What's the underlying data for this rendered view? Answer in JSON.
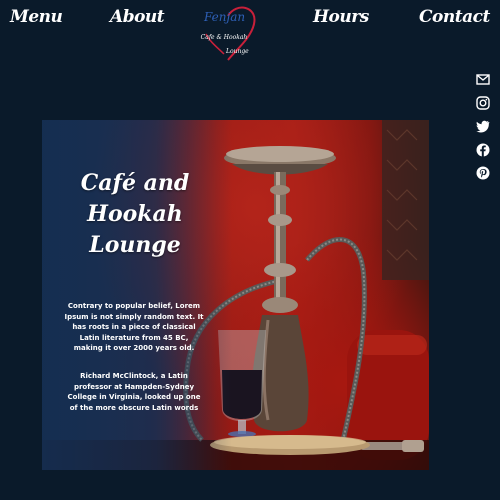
{
  "nav": {
    "menu": "Menu",
    "about": "About",
    "hours": "Hours",
    "contact": "Contact"
  },
  "logo": {
    "name": "Fenjan",
    "line1": "Cafe & Hookah",
    "line2": "Lounge",
    "accent": "#c8203a",
    "name_color": "#2e5fb5"
  },
  "social": {
    "icons": [
      "mail-icon",
      "instagram-icon",
      "twitter-icon",
      "facebook-icon",
      "pinterest-icon"
    ]
  },
  "hero": {
    "title_line1": "Café and",
    "title_line2": "Hookah",
    "title_line3": "Lounge",
    "paragraph1": "Contrary to popular belief, Lorem Ipsum is not simply random text. It has roots in a piece of classical Latin literature from 45 BC, making it over 2000 years old.",
    "paragraph2": "Richard McClintock, a Latin professor at Hampden-Sydney College in Virginia, looked up one of the more obscure Latin words"
  },
  "colors": {
    "background": "#0a1a2a",
    "hero_red": "#a31d16",
    "hero_blue": "#1f3a5c"
  }
}
